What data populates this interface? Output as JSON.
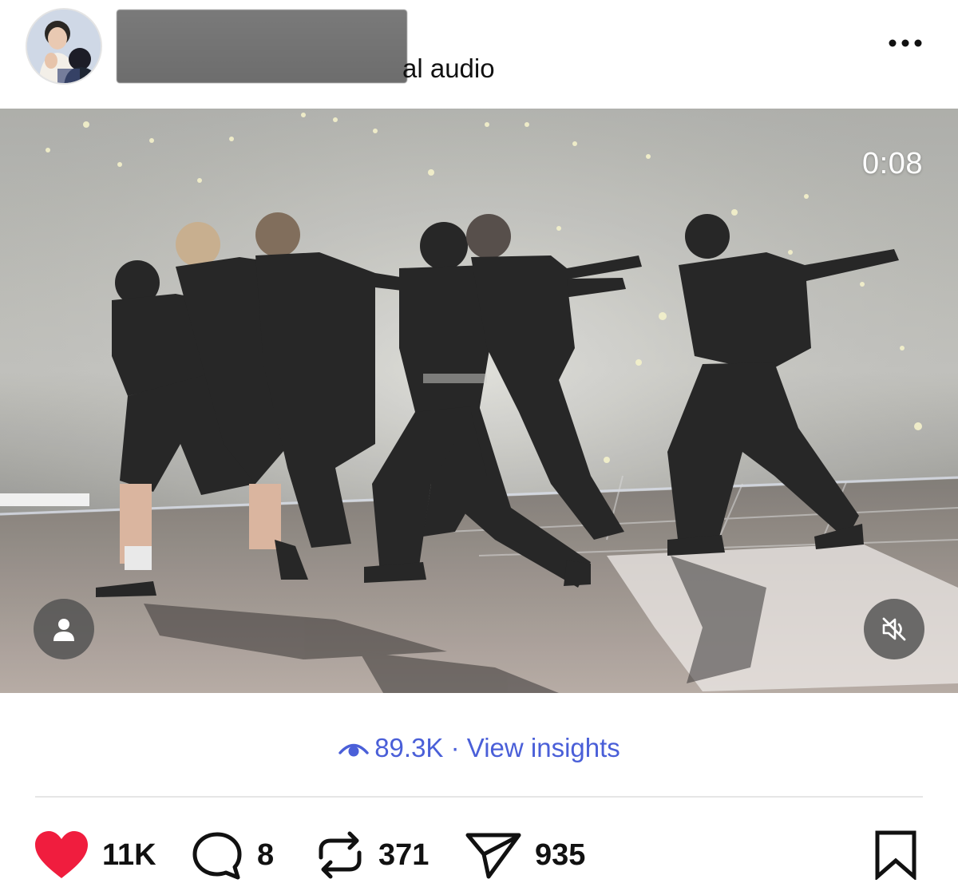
{
  "header": {
    "audio_text": "al audio",
    "more_icon": "more-horizontal-icon"
  },
  "video": {
    "timestamp": "0:08",
    "profile_button_icon": "person-icon",
    "mute_button_icon": "speaker-muted-icon"
  },
  "insights": {
    "views": "89.3K",
    "separator": "·",
    "link": "View insights",
    "icon": "eye-icon",
    "color": "#4a5fd8"
  },
  "actions": {
    "like": {
      "icon": "heart-filled-icon",
      "count": "11K",
      "color": "#f01d3e"
    },
    "comment": {
      "icon": "comment-bubble-icon",
      "count": "8"
    },
    "repost": {
      "icon": "repost-arrows-icon",
      "count": "371"
    },
    "share": {
      "icon": "send-paper-plane-icon",
      "count": "935"
    },
    "save": {
      "icon": "bookmark-outline-icon"
    }
  }
}
